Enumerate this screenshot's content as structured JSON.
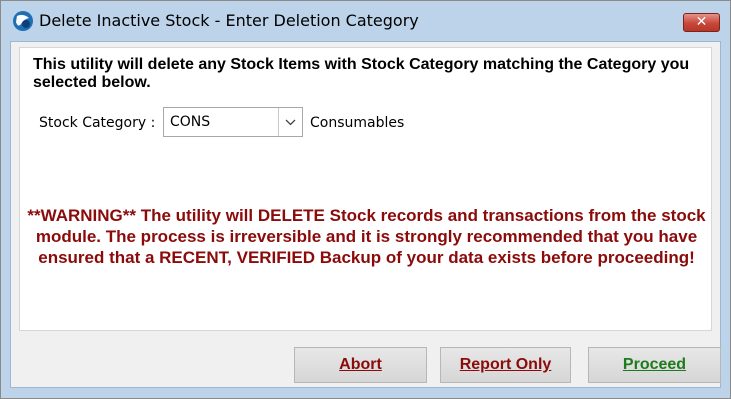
{
  "window": {
    "title": "Delete Inactive Stock - Enter Deletion Category",
    "close_label": "✕"
  },
  "content": {
    "intro": "This utility will delete any Stock Items with Stock Category matching the Category you selected below.",
    "category_label": "Stock Category :",
    "category_value": "CONS",
    "category_description": "Consumables",
    "warning": "**WARNING** The utility will DELETE Stock records and transactions from the stock module. The process is irreversible and it is strongly recommended that you have ensured that a RECENT, VERIFIED Backup of your data exists before proceeding!"
  },
  "buttons": {
    "abort": "Abort",
    "report_only": "Report Only",
    "proceed": "Proceed"
  },
  "colors": {
    "titlebar": "#bcd3ea",
    "warning_text": "#8b0a0a",
    "abort_text": "#8b0a0a",
    "report_text": "#8b0a0a",
    "proceed_text": "#1d7a1d",
    "close_button": "#c8473a"
  },
  "icons": {
    "app": "app-logo-icon",
    "close": "close-icon",
    "dropdown": "chevron-down-icon"
  }
}
